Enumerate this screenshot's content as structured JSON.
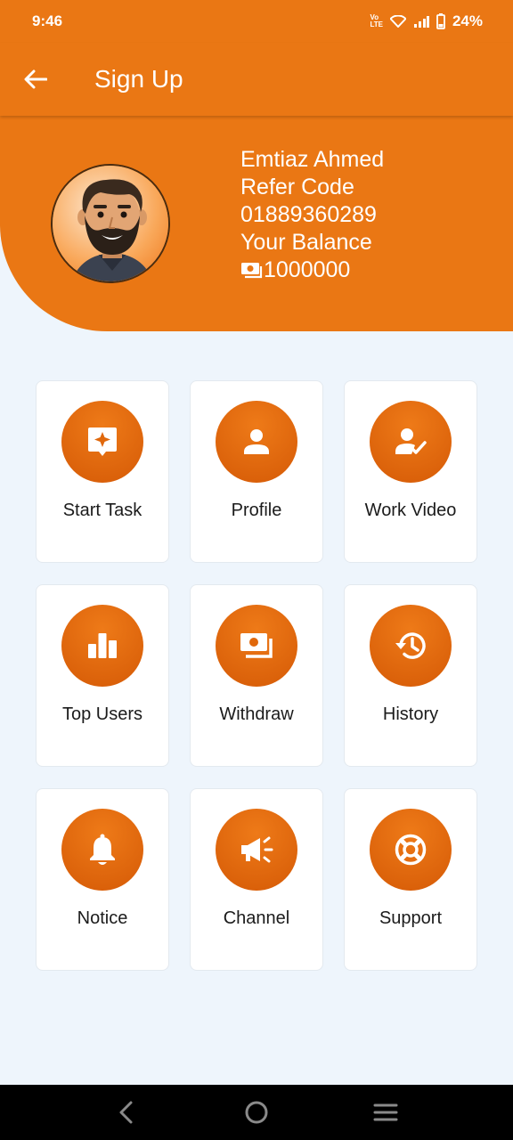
{
  "status_bar": {
    "time": "9:46",
    "network_label": "VoLTE",
    "battery": "24%"
  },
  "app_bar": {
    "title": "Sign Up"
  },
  "profile": {
    "name": "Emtiaz Ahmed",
    "refer_label": "Refer Code",
    "refer_code": "01889360289",
    "balance_label": "Your Balance",
    "balance": "1000000"
  },
  "menu": [
    {
      "label": "Start Task",
      "icon": "task-sparkle-icon"
    },
    {
      "label": "Profile",
      "icon": "person-icon"
    },
    {
      "label": "Work Video",
      "icon": "person-check-icon"
    },
    {
      "label": "Top Users",
      "icon": "bar-chart-icon"
    },
    {
      "label": "Withdraw",
      "icon": "money-icon"
    },
    {
      "label": "History",
      "icon": "history-icon"
    },
    {
      "label": "Notice",
      "icon": "bell-icon"
    },
    {
      "label": "Channel",
      "icon": "megaphone-icon"
    },
    {
      "label": "Support",
      "icon": "lifebuoy-icon"
    }
  ],
  "colors": {
    "primary": "#EA7714",
    "background": "#EEF5FC",
    "tile": "#FFFFFF"
  }
}
